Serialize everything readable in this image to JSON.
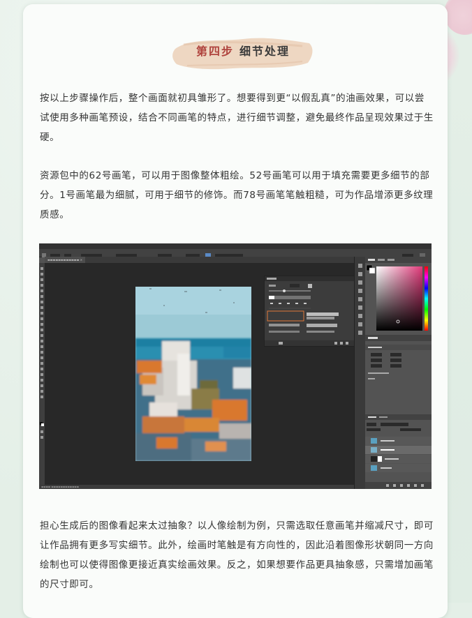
{
  "section": {
    "step_label": "第四步",
    "step_name": "细节处理"
  },
  "paragraphs": [
    "按以上步骤操作后，整个画面就初具雏形了。想要得到更“以假乱真”的油画效果，可以尝试使用多种画笔预设，结合不同画笔的特点，进行细节调整，避免最终作品呈现效果过于生硬。",
    "资源包中的62号画笔，可以用于图像整体粗绘。52号画笔可以用于填充需要更多细节的部分。1号画笔最为细腻，可用于细节的修饰。而78号画笔笔触粗糙，可为作品增添更多纹理质感。",
    "担心生成后的图像看起来太过抽象？以人像绘制为例，只需选取任意画笔并缩减尺寸，即可让作品拥有更多写实细节。此外，绘画时笔触是有方向性的，因此沿着图像形状朝同一方向绘制也可以使得图像更接近真实绘画效果。反之，如果想要作品更具抽象感，只需增加画笔的尺寸即可。"
  ],
  "colors": {
    "step_red": "#b0453f",
    "brush_beige": "#ecd3bb",
    "accent_orange": "#e0783a"
  }
}
